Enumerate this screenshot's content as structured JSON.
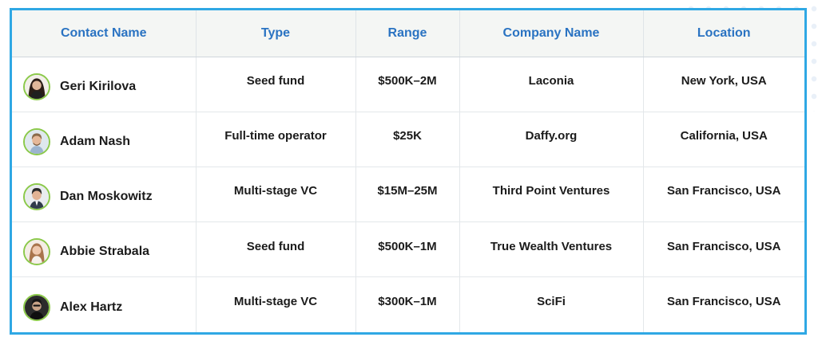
{
  "table": {
    "headers": [
      "Contact Name",
      "Type",
      "Range",
      "Company Name",
      "Location"
    ],
    "rows": [
      {
        "name": "Geri Kirilova",
        "type": "Seed fund",
        "range": "$500K–2M",
        "company": "Laconia",
        "location": "New York, USA",
        "avatar": "person-avatar-icon"
      },
      {
        "name": "Adam Nash",
        "type": "Full-time operator",
        "range": "$25K",
        "company": "Daffy.org",
        "location": "California, USA",
        "avatar": "person-avatar-icon"
      },
      {
        "name": "Dan Moskowitz",
        "type": "Multi-stage VC",
        "range": "$15M–25M",
        "company": "Third Point Ventures",
        "location": "San Francisco, USA",
        "avatar": "person-avatar-icon"
      },
      {
        "name": "Abbie Strabala",
        "type": "Seed fund",
        "range": "$500K–1M",
        "company": "True Wealth Ventures",
        "location": "San Francisco, USA",
        "avatar": "person-avatar-icon"
      },
      {
        "name": "Alex Hartz",
        "type": "Multi-stage VC",
        "range": "$300K–1M",
        "company": "SciFi",
        "location": "San Francisco, USA",
        "avatar": "person-avatar-icon"
      }
    ]
  },
  "colors": {
    "frame_border": "#2fa8e4",
    "header_text": "#2a73c2",
    "header_bg": "#f4f6f4",
    "avatar_ring": "#8bc94a",
    "body_text": "#1b1b1b"
  }
}
